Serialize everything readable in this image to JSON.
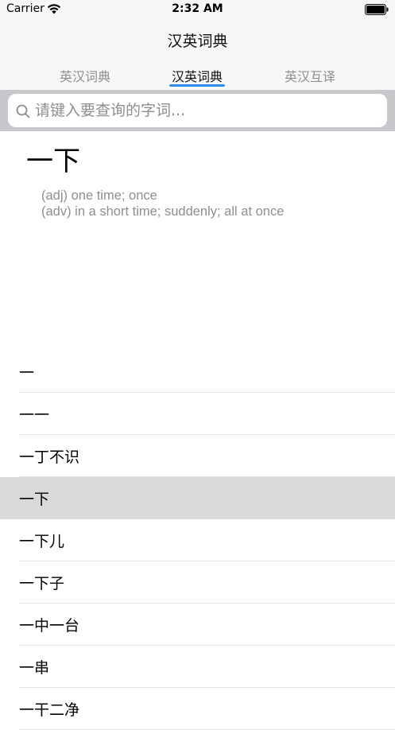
{
  "status_bar": {
    "carrier": "Carrier",
    "time": "2:32 AM"
  },
  "nav": {
    "title": "汉英词典",
    "tabs": [
      {
        "label": "英汉词典",
        "active": false
      },
      {
        "label": "汉英词典",
        "active": true
      },
      {
        "label": "英汉互译",
        "active": false
      }
    ],
    "accent_color": "#2f8ceb"
  },
  "search": {
    "placeholder": "请键入要查询的字词...",
    "value": ""
  },
  "detail": {
    "headword": "一下",
    "definitions": [
      "(adj) one time; once",
      "(adv) in a short time; suddenly; all at once"
    ]
  },
  "list": {
    "items": [
      {
        "text": "一",
        "selected": false
      },
      {
        "text": "一一",
        "selected": false
      },
      {
        "text": "一丁不识",
        "selected": false
      },
      {
        "text": "一下",
        "selected": true
      },
      {
        "text": "一下儿",
        "selected": false
      },
      {
        "text": "一下子",
        "selected": false
      },
      {
        "text": "一中一台",
        "selected": false
      },
      {
        "text": "一串",
        "selected": false
      },
      {
        "text": "一干二净",
        "selected": false
      }
    ]
  }
}
